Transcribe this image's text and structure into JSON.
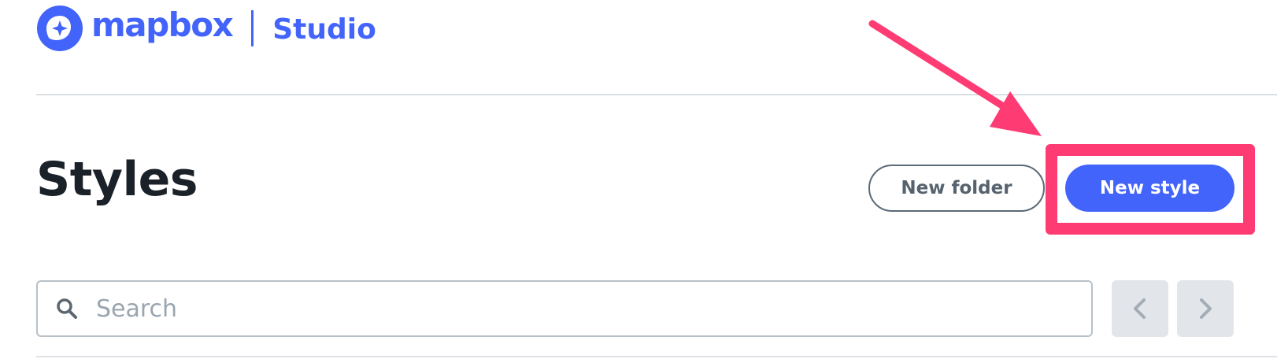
{
  "brand": {
    "name": "mapbox",
    "product": "Studio",
    "color": "#4264fb",
    "logo_icon": "mapbox-logo-icon"
  },
  "main": {
    "title": "Styles"
  },
  "actions": {
    "new_folder_label": "New folder",
    "new_style_label": "New style"
  },
  "search": {
    "placeholder": "Search",
    "value": "",
    "icon": "search-icon"
  },
  "pagination": {
    "prev_icon": "chevron-left-icon",
    "next_icon": "chevron-right-icon"
  },
  "annotation": {
    "color": "#ff3b73",
    "target": "new-style-button"
  }
}
